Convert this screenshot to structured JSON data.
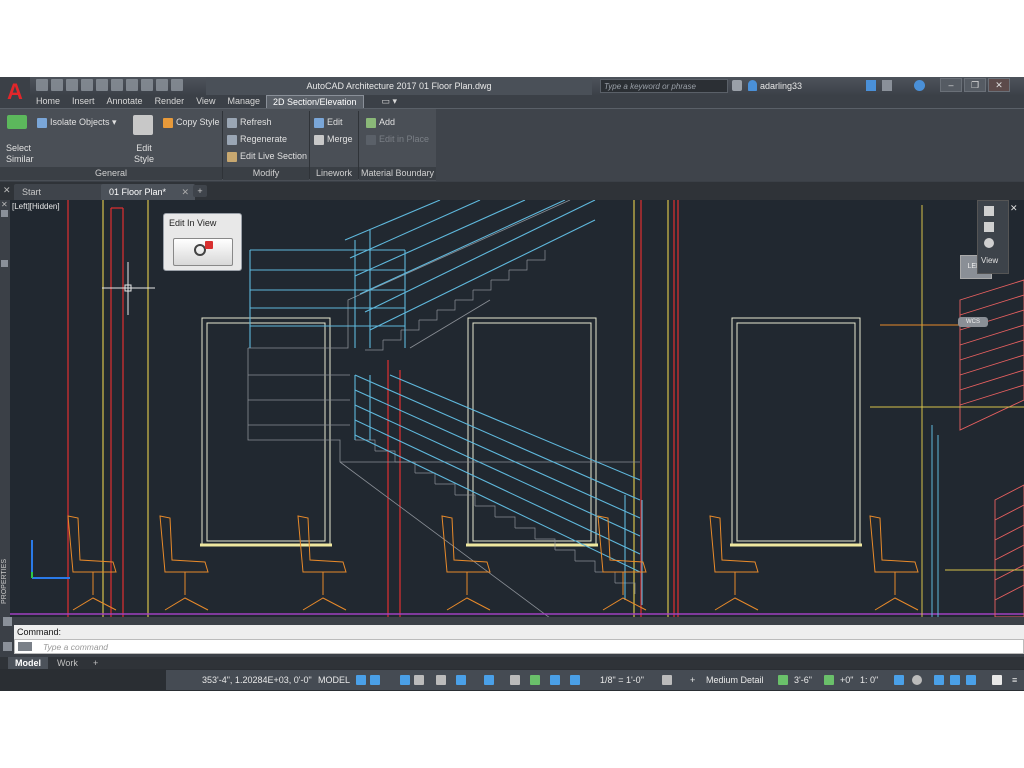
{
  "app": {
    "title": "AutoCAD Architecture 2017   01 Floor Plan.dwg",
    "logo_letter": "A",
    "search_placeholder": "Type a keyword or phrase",
    "user_name": "adarling33"
  },
  "ribbon": {
    "tabs": [
      "Home",
      "Insert",
      "Annotate",
      "Render",
      "View",
      "Manage",
      "2D Section/Elevation"
    ],
    "active_tab": "2D Section/Elevation",
    "panels": {
      "general": {
        "title": "General",
        "select_similar_line1": "Select",
        "select_similar_line2": "Similar",
        "isolate_objects": "Isolate Objects",
        "edit_style_line1": "Edit",
        "edit_style_line2": "Style",
        "copy_style": "Copy Style"
      },
      "modify": {
        "title": "Modify",
        "refresh": "Refresh",
        "regenerate": "Regenerate",
        "edit_live_section": "Edit Live Section"
      },
      "linework": {
        "title": "Linework",
        "edit": "Edit",
        "merge": "Merge"
      },
      "material_boundary": {
        "title": "Material Boundary",
        "add": "Add",
        "edit_in_place": "Edit in Place"
      }
    }
  },
  "file_tabs": {
    "start": "Start",
    "active": "01 Floor Plan*"
  },
  "viewport": {
    "view_label": "[Left][Hidden]",
    "edit_in_view_title": "Edit In View",
    "viewcube_label": "LEFT",
    "wcs_label": "WCS",
    "nav_label": "View",
    "properties_label": "PROPERTIES"
  },
  "command": {
    "history": "Command:",
    "placeholder": "Type  a  command"
  },
  "layout_tabs": [
    "Model",
    "Work"
  ],
  "status": {
    "coords": "353'-4\", 1.20284E+03, 0'-0\"",
    "space": "MODEL",
    "scale": "1/8\" = 1'-0\"",
    "detail": "Medium Detail",
    "elevation": "3'-6\"",
    "offset": "+0\"",
    "ratio": "1: 0\""
  },
  "colors": {
    "stair_blue": "#5fb8dc",
    "wall_red": "#e03030",
    "yellow": "#d6c24a",
    "chair_orange": "#e88a2a",
    "right_stair_red": "#e86060",
    "background": "#212830"
  }
}
